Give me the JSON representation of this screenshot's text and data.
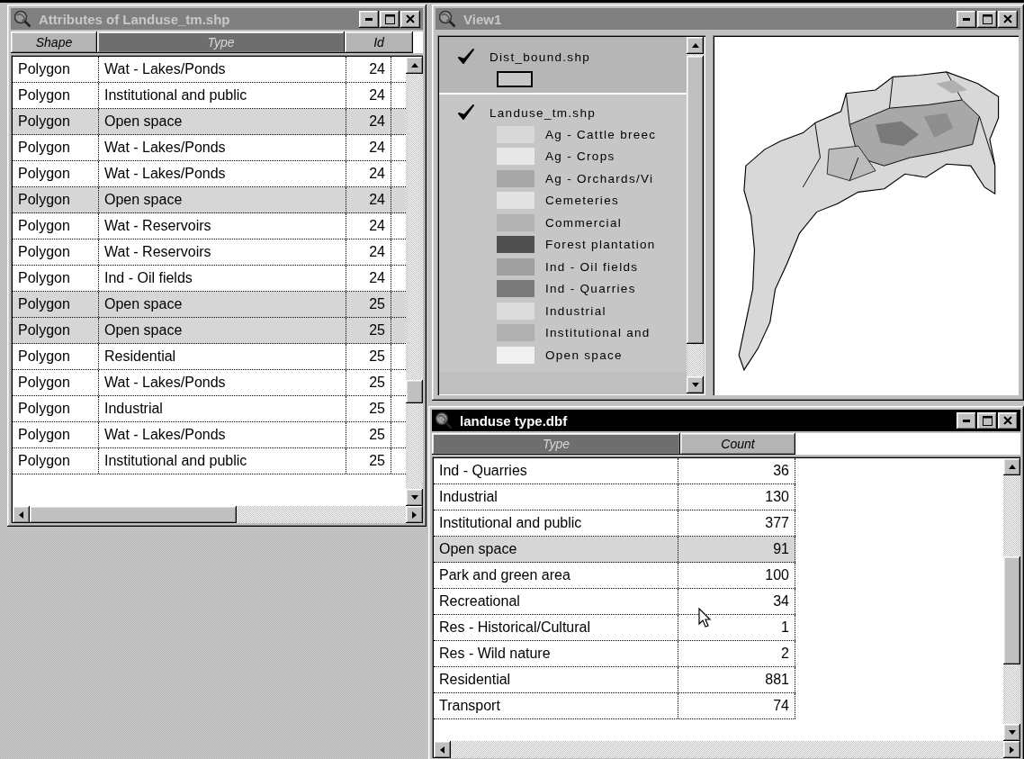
{
  "attributes_window": {
    "title": "Attributes of Landuse_tm.shp",
    "active": false,
    "columns": [
      {
        "label": "Shape",
        "selected": false
      },
      {
        "label": "Type",
        "selected": true
      },
      {
        "label": "Id",
        "selected": false
      }
    ],
    "rows": [
      {
        "cells": [
          "Polygon",
          "Wat - Lakes/Ponds",
          "24"
        ],
        "selected": false
      },
      {
        "cells": [
          "Polygon",
          "Institutional and public",
          "24"
        ],
        "selected": false
      },
      {
        "cells": [
          "Polygon",
          "Open space",
          "24"
        ],
        "selected": true
      },
      {
        "cells": [
          "Polygon",
          "Wat - Lakes/Ponds",
          "24"
        ],
        "selected": false
      },
      {
        "cells": [
          "Polygon",
          "Wat - Lakes/Ponds",
          "24"
        ],
        "selected": false
      },
      {
        "cells": [
          "Polygon",
          "Open space",
          "24"
        ],
        "selected": true
      },
      {
        "cells": [
          "Polygon",
          "Wat - Reservoirs",
          "24"
        ],
        "selected": false
      },
      {
        "cells": [
          "Polygon",
          "Wat - Reservoirs",
          "24"
        ],
        "selected": false
      },
      {
        "cells": [
          "Polygon",
          "Ind - Oil fields",
          "24"
        ],
        "selected": false
      },
      {
        "cells": [
          "Polygon",
          "Open space",
          "25"
        ],
        "selected": true
      },
      {
        "cells": [
          "Polygon",
          "Open space",
          "25"
        ],
        "selected": true
      },
      {
        "cells": [
          "Polygon",
          "Residential",
          "25"
        ],
        "selected": false
      },
      {
        "cells": [
          "Polygon",
          "Wat - Lakes/Ponds",
          "25"
        ],
        "selected": false
      },
      {
        "cells": [
          "Polygon",
          "Industrial",
          "25"
        ],
        "selected": false
      },
      {
        "cells": [
          "Polygon",
          "Wat - Lakes/Ponds",
          "25"
        ],
        "selected": false
      },
      {
        "cells": [
          "Polygon",
          "Institutional and public",
          "25"
        ],
        "selected": false
      }
    ]
  },
  "view_window": {
    "title": "View1",
    "active": false,
    "layers": [
      {
        "name": "Dist_bound.shp",
        "checked": true,
        "selected": false,
        "kind": "outline"
      },
      {
        "name": "Landuse_tm.shp",
        "checked": true,
        "selected": true,
        "kind": "classes",
        "classes": [
          {
            "label": "Ag - Cattle breec",
            "color": "#d8d8d8"
          },
          {
            "label": "Ag - Crops",
            "color": "#e8e8e8"
          },
          {
            "label": "Ag - Orchards/Vi",
            "color": "#a8a8a8"
          },
          {
            "label": "Cemeteries",
            "color": "#e2e2e2"
          },
          {
            "label": "Commercial",
            "color": "#b2b2b2"
          },
          {
            "label": "Forest plantation",
            "color": "#505050"
          },
          {
            "label": "Ind - Oil fields",
            "color": "#a0a0a0"
          },
          {
            "label": "Ind - Quarries",
            "color": "#7a7a7a"
          },
          {
            "label": "Industrial",
            "color": "#dcdcdc"
          },
          {
            "label": "Institutional and",
            "color": "#b0b0b0"
          },
          {
            "label": "Open space",
            "color": "#f0f0f0"
          }
        ]
      }
    ]
  },
  "table_window": {
    "title": "landuse type.dbf",
    "active": true,
    "columns": [
      {
        "label": "Type",
        "selected": true
      },
      {
        "label": "Count",
        "selected": false
      }
    ],
    "rows": [
      {
        "cells": [
          "Ind - Quarries",
          "36"
        ],
        "selected": false
      },
      {
        "cells": [
          "Industrial",
          "130"
        ],
        "selected": false
      },
      {
        "cells": [
          "Institutional and public",
          "377"
        ],
        "selected": false
      },
      {
        "cells": [
          "Open space",
          "91"
        ],
        "selected": true
      },
      {
        "cells": [
          "Park and green area",
          "100"
        ],
        "selected": false
      },
      {
        "cells": [
          "Recreational",
          "34"
        ],
        "selected": false
      },
      {
        "cells": [
          "Res - Historical/Cultural",
          "1"
        ],
        "selected": false
      },
      {
        "cells": [
          "Res - Wild nature",
          "2"
        ],
        "selected": false
      },
      {
        "cells": [
          "Residential",
          "881"
        ],
        "selected": false
      },
      {
        "cells": [
          "Transport",
          "74"
        ],
        "selected": false
      }
    ]
  }
}
